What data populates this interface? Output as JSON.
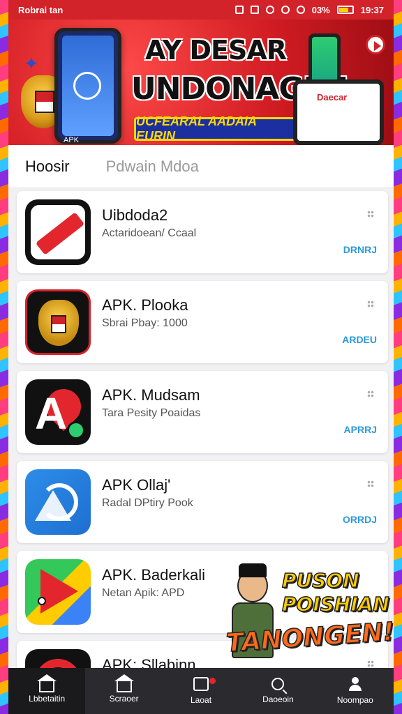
{
  "status_bar": {
    "carrier": "Robrai tan",
    "battery": "03%",
    "time": "19:37"
  },
  "banner": {
    "title_line1": "AY DESAR",
    "title_line2": "UNDONAGIAI",
    "subtitle": "UCFEARAL AADAIA EURIN",
    "phone_text": "APK",
    "right_mock_text": "Daecar"
  },
  "tabs": [
    {
      "label": "Hoosir",
      "active": true
    },
    {
      "label": "Pdwain Mdoa",
      "active": false
    }
  ],
  "apps": [
    {
      "name": "Uibdoda2",
      "subtitle": "Actaridoean/ Ccaal",
      "action": "DRNRJ",
      "icon": "red-slash-icon"
    },
    {
      "name": "APK. Plooka",
      "subtitle": "Sbrai Pbay: 1000",
      "action": "ARDEU",
      "icon": "garuda-icon"
    },
    {
      "name": "APK. Mudsam",
      "subtitle": "Tara Pesity Poaidas",
      "action": "APRRJ",
      "icon": "map-pin-icon"
    },
    {
      "name": "APK Ollaj'",
      "subtitle": "Radal DPtiry Pook",
      "action": "ORRDJ",
      "icon": "blue-arc-icon"
    },
    {
      "name": "APK. Baderkali",
      "subtitle": "Netan Apik: APD",
      "action": "",
      "icon": "play-store-icon"
    },
    {
      "name": "APK; Sllabinn",
      "subtitle": "",
      "action": "",
      "icon": "red-circle-icon"
    }
  ],
  "promo": {
    "line1": "PUSON",
    "line2": "POISHIAN",
    "line3": "TANONGEN!"
  },
  "bottom_nav": [
    {
      "label": "Lbbetaitin",
      "icon": "home-icon",
      "active": true
    },
    {
      "label": "Scraoer",
      "icon": "home-outline-icon",
      "active": false
    },
    {
      "label": "Laoat",
      "icon": "box-icon",
      "active": false,
      "badge": true
    },
    {
      "label": "Daoeoin",
      "icon": "search-icon",
      "active": false
    },
    {
      "label": "Noompao",
      "icon": "user-icon",
      "active": false
    }
  ],
  "colors": {
    "brand_red": "#d2232a",
    "action_blue": "#2b9ad8",
    "nav_bg": "#2b2b2f"
  }
}
